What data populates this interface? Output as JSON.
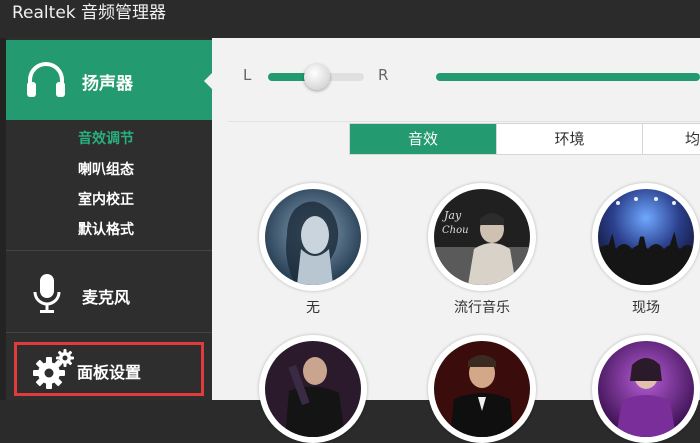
{
  "window": {
    "title": "Realtek 音频管理器"
  },
  "sidebar": {
    "speaker_tab": {
      "label": "扬声器",
      "icon": "headphones-icon"
    },
    "submenu": [
      {
        "label": "音效调节",
        "active": true
      },
      {
        "label": "喇叭组态",
        "active": false
      },
      {
        "label": "室内校正",
        "active": false
      },
      {
        "label": "默认格式",
        "active": false
      }
    ],
    "mic_tab": {
      "label": "麦克风",
      "icon": "microphone-icon"
    },
    "panel_settings": {
      "label": "面板设置",
      "icon": "gears-icon"
    }
  },
  "balance": {
    "left_label": "L",
    "right_label": "R",
    "value": 0.5
  },
  "tabs": [
    {
      "label": "音效",
      "active": true
    },
    {
      "label": "环境",
      "active": false
    },
    {
      "label": "均",
      "active": false
    }
  ],
  "presets": [
    {
      "label": "无"
    },
    {
      "label": "流行音乐"
    },
    {
      "label": "现场"
    },
    {
      "label": ""
    },
    {
      "label": ""
    },
    {
      "label": ""
    }
  ],
  "colors": {
    "accent": "#239a6f",
    "highlight": "#e23b3b",
    "sidebar_bg": "#2e2e2e",
    "main_bg": "#f2f2f2"
  }
}
